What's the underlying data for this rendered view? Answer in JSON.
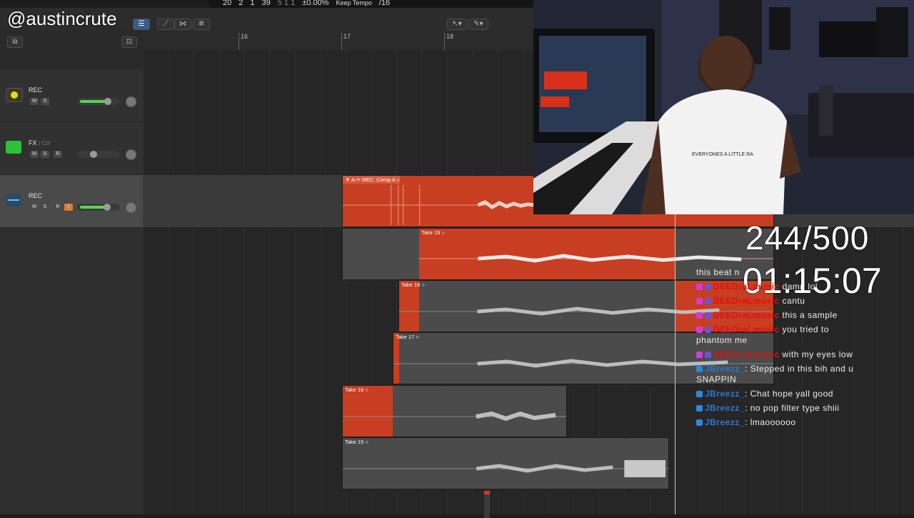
{
  "watermark": "@austincrute",
  "transport": {
    "bar": "20",
    "beat": "2",
    "div": "1",
    "tick": "39",
    "pos2": "5  1  1",
    "percent": "±0.00%",
    "tempo_mode": "Keep Tempo",
    "signature": "/16"
  },
  "ruler": {
    "marks": [
      "16",
      "17",
      "18"
    ]
  },
  "tracks": [
    {
      "name": "REC",
      "sub": "",
      "buttons": [
        "M",
        "S"
      ]
    },
    {
      "name": "FX",
      "sub": "| Ctrl",
      "buttons": [
        "M",
        "S",
        "R"
      ]
    },
    {
      "name": "REC",
      "sub": "",
      "buttons": [
        "M",
        "S",
        "R",
        "I"
      ]
    }
  ],
  "regions": {
    "comp": "REC: Comp A",
    "takes": [
      "Take 19",
      "Take 18",
      "Take 17",
      "Take 16",
      "Take 15"
    ]
  },
  "stream": {
    "counter": "244/500",
    "timer": "01:15:07"
  },
  "shirt_text": "EVERYONES A LITTLE RA",
  "chat": [
    {
      "user": "",
      "text": "this beat n"
    },
    {
      "user": "DEEDraLmusic",
      "text": "damn lol"
    },
    {
      "user": "DEEDraLmusic",
      "text": "cantu"
    },
    {
      "user": "DEEDraLmusic",
      "text": "this a sample"
    },
    {
      "user": "DEEDraLmusic",
      "text": "you tried to"
    },
    {
      "user": "",
      "text": "phantom me"
    },
    {
      "user": "DEEDraLmusic",
      "text": "with my eyes low"
    },
    {
      "user": "JBreezz_",
      "text": "Stepped in this bih and u"
    },
    {
      "user": "",
      "text": "SNAPPIN"
    },
    {
      "user": "JBreezz_",
      "text": "Chat hope yall good"
    },
    {
      "user": "JBreezz_",
      "text": "no pop filter type shiii"
    },
    {
      "user": "JBreezz_",
      "text": "lmaoooooo"
    }
  ],
  "colors": {
    "region_orange": "#c83e22",
    "region_grey": "#4b4b4b",
    "volume_green": "#55d655",
    "user_red": "#e01010",
    "user_blue": "#2a7ad6"
  }
}
